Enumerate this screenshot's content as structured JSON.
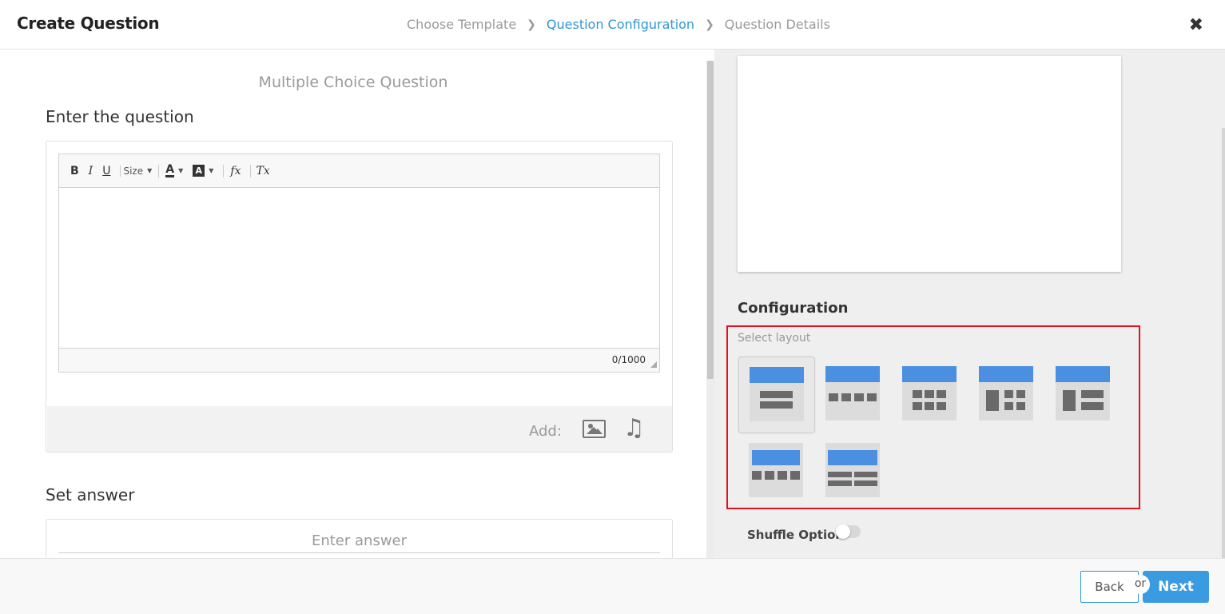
{
  "header": {
    "title": "Create Question",
    "breadcrumb": [
      {
        "label": "Choose Template",
        "active": false
      },
      {
        "label": "Question Configuration",
        "active": true
      },
      {
        "label": "Question Details",
        "active": false
      }
    ],
    "close_icon": "close-icon"
  },
  "question": {
    "type_title": "Multiple Choice Question",
    "heading": "Enter the question",
    "toolbar": {
      "bold": "B",
      "italic": "I",
      "underline": "U",
      "size_label": "Size",
      "text_color": "A",
      "bg_color": "A",
      "formula": "fx",
      "clear_format": "Tx"
    },
    "char_counter": "0/1000",
    "add_label": "Add:"
  },
  "answer": {
    "heading": "Set answer",
    "placeholder": "Enter answer"
  },
  "configuration": {
    "title": "Configuration",
    "select_layout_label": "Select layout",
    "layouts": [
      {
        "name": "layout-1",
        "selected": true
      },
      {
        "name": "layout-2",
        "selected": false
      },
      {
        "name": "layout-3",
        "selected": false
      },
      {
        "name": "layout-4",
        "selected": false
      },
      {
        "name": "layout-5",
        "selected": false
      },
      {
        "name": "layout-6",
        "selected": false
      },
      {
        "name": "layout-7",
        "selected": false
      }
    ],
    "shuffle_label": "Shuffle Option",
    "shuffle_on": false
  },
  "footer": {
    "back_label": "Back",
    "or_label": "or",
    "next_label": "Next"
  },
  "colors": {
    "accent": "#2f97d4",
    "next_button": "#3a9be0",
    "layout_header": "#4a8fe0",
    "highlight_border": "#e0141e"
  }
}
